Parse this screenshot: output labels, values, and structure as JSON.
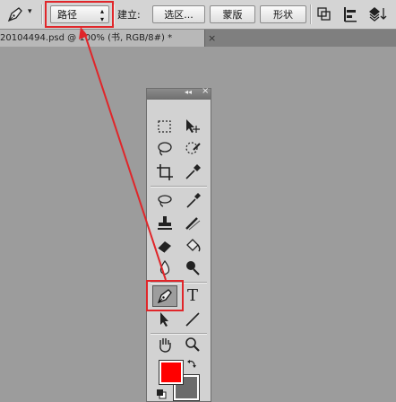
{
  "options_bar": {
    "mode_select_value": "路径",
    "create_label": "建立:",
    "selection_button": "选区...",
    "mask_button": "蒙版",
    "shape_button": "形状"
  },
  "document_tab": {
    "title": "20104494.psd @ 100% (书, RGB/8#) *",
    "close_glyph": "×"
  },
  "tools_panel": {
    "collapse_glyph": "◂◂",
    "close_glyph": "×",
    "type_tool_glyph": "T"
  },
  "annotations": {
    "arrow_color": "#e0262a"
  },
  "colors": {
    "foreground": "#ff0000",
    "background": "#6b6b6b"
  }
}
